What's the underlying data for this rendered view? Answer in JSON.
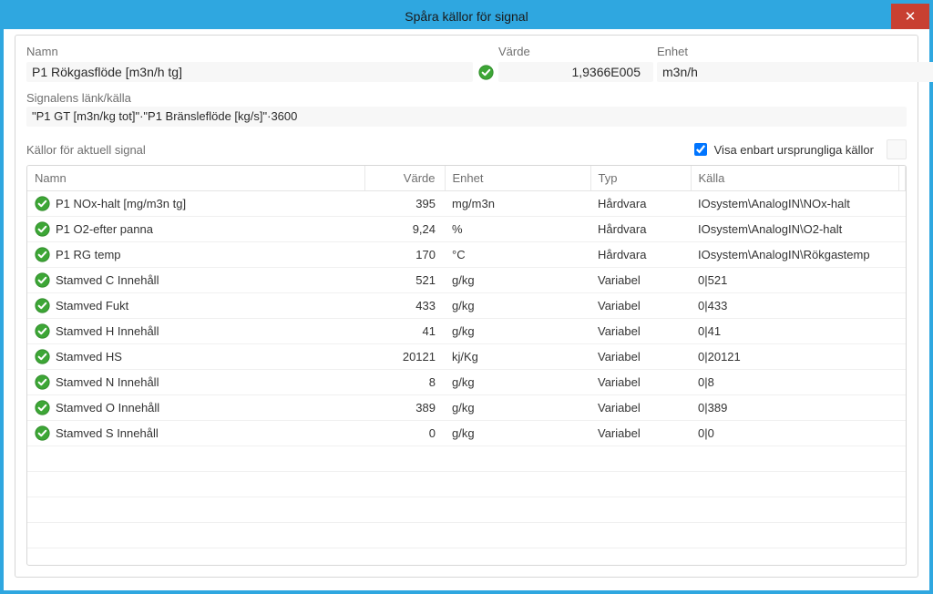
{
  "window": {
    "title": "Spåra källor för signal"
  },
  "header": {
    "labels": {
      "name": "Namn",
      "value": "Värde",
      "unit": "Enhet"
    },
    "name": "P1 Rökgasflöde [m3n/h tg]",
    "value": "1,9366E005",
    "unit": "m3n/h"
  },
  "link": {
    "label": "Signalens länk/källa",
    "formula": "\"P1 GT [m3n/kg tot]\"·\"P1 Bränsleflöde [kg/s]\"·3600"
  },
  "sources": {
    "title": "Källor för aktuell signal",
    "filter_label": "Visa enbart ursprungliga källor",
    "filter_checked": true,
    "columns": {
      "name": "Namn",
      "value": "Värde",
      "unit": "Enhet",
      "type": "Typ",
      "source": "Källa"
    },
    "rows": [
      {
        "name": "P1 NOx-halt [mg/m3n tg]",
        "value": "395",
        "unit": "mg/m3n",
        "type": "Hårdvara",
        "source": "IOsystem\\AnalogIN\\NOx-halt"
      },
      {
        "name": "P1 O2-efter panna",
        "value": "9,24",
        "unit": "%",
        "type": "Hårdvara",
        "source": "IOsystem\\AnalogIN\\O2-halt"
      },
      {
        "name": "P1 RG temp",
        "value": "170",
        "unit": "°C",
        "type": "Hårdvara",
        "source": "IOsystem\\AnalogIN\\Rökgastemp"
      },
      {
        "name": "Stamved C Innehåll",
        "value": "521",
        "unit": "g/kg",
        "type": "Variabel",
        "source": "0|521"
      },
      {
        "name": "Stamved Fukt",
        "value": "433",
        "unit": "g/kg",
        "type": "Variabel",
        "source": "0|433"
      },
      {
        "name": "Stamved H Innehåll",
        "value": "41",
        "unit": "g/kg",
        "type": "Variabel",
        "source": "0|41"
      },
      {
        "name": "Stamved HS",
        "value": "20121",
        "unit": "kj/Kg",
        "type": "Variabel",
        "source": "0|20121"
      },
      {
        "name": "Stamved N Innehåll",
        "value": "8",
        "unit": "g/kg",
        "type": "Variabel",
        "source": "0|8"
      },
      {
        "name": "Stamved O Innehåll",
        "value": "389",
        "unit": "g/kg",
        "type": "Variabel",
        "source": "0|389"
      },
      {
        "name": "Stamved S Innehåll",
        "value": "0",
        "unit": "g/kg",
        "type": "Variabel",
        "source": "0|0"
      }
    ]
  },
  "icons": {
    "status_ok": "green-check"
  }
}
